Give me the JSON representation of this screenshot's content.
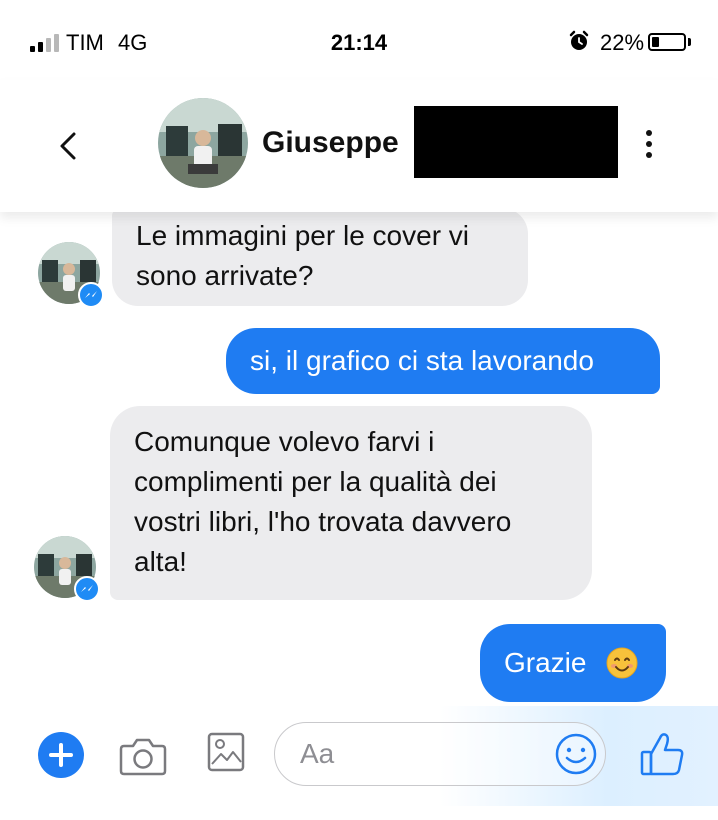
{
  "status_bar": {
    "carrier": "TIM",
    "network": "4G",
    "time": "21:14",
    "battery_percent": "22%",
    "battery_level": 0.22,
    "signal_bars_active": 2,
    "signal_bars_total": 4
  },
  "header": {
    "contact_name": "Giuseppe",
    "back_icon": "chevron-left-icon",
    "menu_icon": "vertical-dots-icon"
  },
  "messages": [
    {
      "direction": "incoming",
      "lines": [
        "Le immagini per le cover vi",
        "sono arrivate?"
      ]
    },
    {
      "direction": "outgoing",
      "lines": [
        "si, il grafico ci sta lavorando"
      ]
    },
    {
      "direction": "incoming",
      "lines": [
        "Comunque volevo farvi i",
        "complimenti per la qualità dei",
        "vostri libri, l'ho trovata davvero",
        "alta!"
      ]
    },
    {
      "direction": "outgoing",
      "lines": [
        "Grazie"
      ],
      "emoji": "smiling-face-emoji"
    }
  ],
  "composer": {
    "placeholder": "Aa",
    "icons": [
      "plus-icon",
      "camera-icon",
      "image-icon",
      "emoji-icon",
      "thumbs-up-icon"
    ]
  },
  "colors": {
    "accent": "#1f7cf2",
    "incoming_bubble": "#ececee",
    "outgoing_bubble": "#1f7cf2",
    "badge": "#1f8bf5"
  }
}
